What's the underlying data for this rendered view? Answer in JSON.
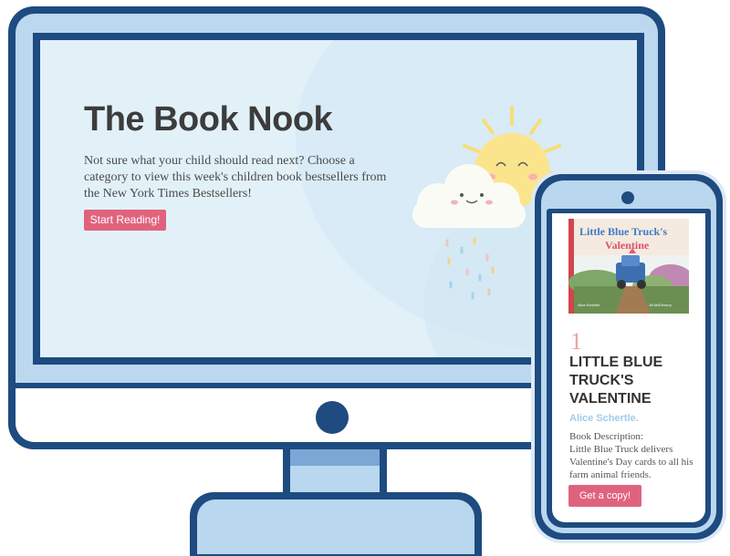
{
  "hero": {
    "title": "The Book Nook",
    "description": "Not sure what your child should read next? Choose a category to view this week's children book bestsellers from the New York Times Bestsellers!",
    "cta_label": "Start Reading!"
  },
  "book": {
    "cover_title_line1": "Little Blue Truck's",
    "cover_title_line2": "Valentine",
    "cover_author": "Alice Schertle",
    "cover_illustrator": "Jill McElmurry",
    "rank": "1",
    "title": "LITTLE BLUE TRUCK'S VALENTINE",
    "author": "Alice Schertle.",
    "description_label": "Book Description:",
    "description": "Little Blue Truck delivers Valentine's Day cards to all his farm animal friends.",
    "cta_label": "Get a copy!"
  },
  "icons": {
    "sun": "sun-icon",
    "cloud": "cloud-icon",
    "monitor_camera": "camera-icon",
    "phone_camera": "camera-icon"
  },
  "colors": {
    "frame": "#1e4b80",
    "bezel": "#bcd8ee",
    "screen_bg": "#e2f1f8",
    "button": "#e0637e",
    "author": "#9fcdea",
    "rank": "#e9a2a8"
  }
}
